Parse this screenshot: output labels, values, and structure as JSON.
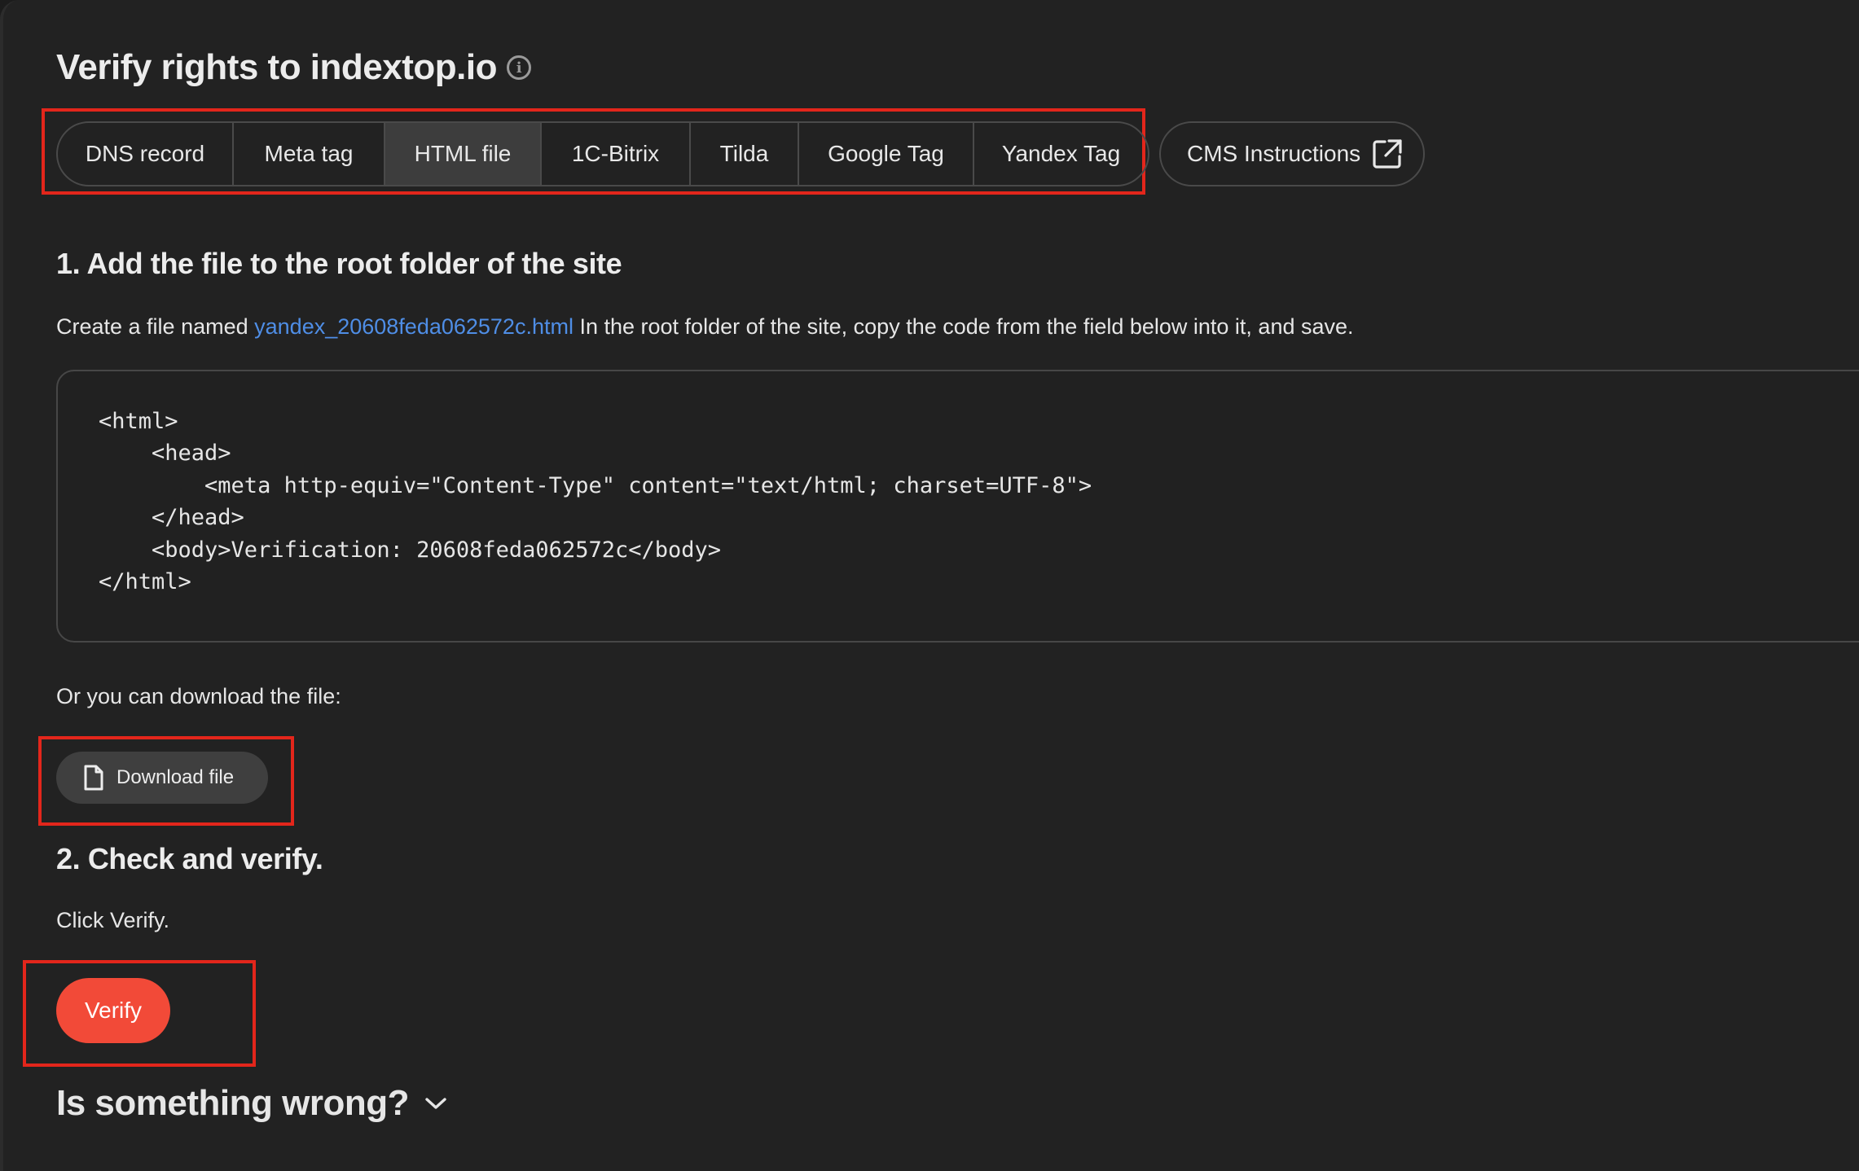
{
  "header": {
    "title": "Verify rights to indextop.io",
    "info_icon": "info-icon"
  },
  "tabs": [
    {
      "label": "DNS record",
      "active": false
    },
    {
      "label": "Meta tag",
      "active": false
    },
    {
      "label": "HTML file",
      "active": true
    },
    {
      "label": "1C-Bitrix",
      "active": false
    },
    {
      "label": "Tilda",
      "active": false
    },
    {
      "label": "Google Tag",
      "active": false
    },
    {
      "label": "Yandex Tag",
      "active": false
    }
  ],
  "cms_button": {
    "label": "CMS Instructions",
    "icon": "external-link-icon"
  },
  "step1": {
    "heading": "1. Add the file to the root folder of the site",
    "text_before": "Create a file named ",
    "file_name": "yandex_20608feda062572c.html",
    "text_after": " In the root folder of the site, copy the code from the field below into it, and save.",
    "code_lines": [
      "<html>",
      "    <head>",
      "        <meta http-equiv=\"Content-Type\" content=\"text/html; charset=UTF-8\">",
      "    </head>",
      "    <body>Verification: 20608feda062572c</body>",
      "</html>"
    ],
    "download_text": "Or you can download the file:",
    "download_button": "Download file",
    "download_icon": "file-icon"
  },
  "step2": {
    "heading": "2. Check and verify.",
    "text": "Click Verify.",
    "verify_button": "Verify"
  },
  "troubleshoot": {
    "label": "Is something wrong?",
    "icon": "chevron-down-icon"
  },
  "colors": {
    "background": "#222222",
    "accent": "#f24a38",
    "link": "#4f8ee6",
    "highlight": "#e3261b",
    "active_tab": "#3d3d3d"
  }
}
